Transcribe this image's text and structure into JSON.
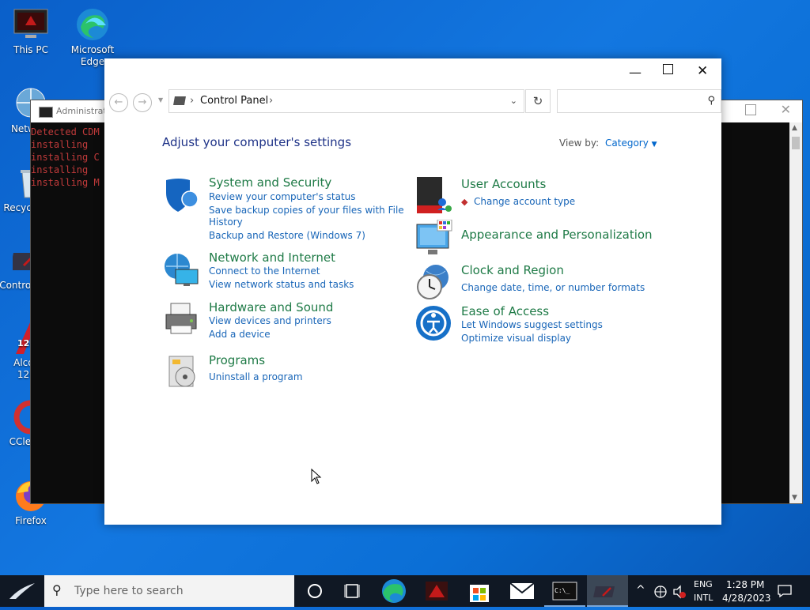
{
  "desktop": {
    "icons": [
      {
        "label": "This PC"
      },
      {
        "label": "Microsoft Edge"
      },
      {
        "label": "Network"
      },
      {
        "label": "Recycle Bin"
      },
      {
        "label": "Control Panel"
      },
      {
        "label": "Alcohol 120%"
      },
      {
        "label": "CCleaner"
      },
      {
        "label": "Firefox"
      }
    ]
  },
  "cmd_window": {
    "title": "Administrator",
    "lines": [
      "Detected CDM",
      "installing",
      "installing C",
      "installing",
      "installing M"
    ]
  },
  "window": {
    "breadcrumb": "Control Panel",
    "search_placeholder": "",
    "heading": "Adjust your computer's settings",
    "view_by_label": "View by:",
    "view_by_value": "Category",
    "categories_left": [
      {
        "title": "System and Security",
        "links": [
          "Review your computer's status",
          "Save backup copies of your files with File",
          "History",
          "Backup and Restore (Windows 7)"
        ]
      },
      {
        "title": "Network and Internet",
        "links": [
          "Connect to the Internet",
          "View network status and tasks"
        ]
      },
      {
        "title": "Hardware and Sound",
        "links": [
          "View devices and printers",
          "Add a device"
        ]
      },
      {
        "title": "Programs",
        "links": [
          "Uninstall a program"
        ]
      }
    ],
    "categories_right": [
      {
        "title": "User Accounts",
        "links": [
          "Change account type"
        ]
      },
      {
        "title": "Appearance and Personalization",
        "links": []
      },
      {
        "title": "Clock and Region",
        "links": [
          "Change date, time, or number formats"
        ]
      },
      {
        "title": "Ease of Access",
        "links": [
          "Let Windows suggest settings",
          "Optimize visual display"
        ]
      }
    ]
  },
  "taskbar": {
    "search_placeholder": "Type here to search",
    "lang_top": "ENG",
    "lang_bottom": "INTL",
    "time": "1:28 PM",
    "date": "4/28/2023"
  }
}
